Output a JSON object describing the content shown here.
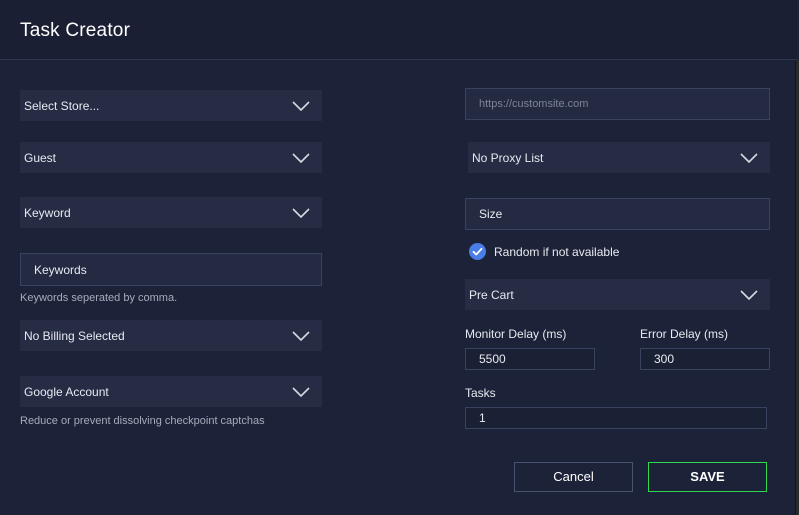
{
  "window": {
    "title": "Task Creator"
  },
  "left": {
    "store": {
      "value": "Select Store..."
    },
    "profile": {
      "value": "Guest"
    },
    "mode": {
      "value": "Keyword"
    },
    "keywords": {
      "placeholder": "Keywords",
      "helper": "Keywords seperated by comma."
    },
    "billing": {
      "value": "No Billing Selected"
    },
    "account": {
      "value": "Google Account",
      "helper": "Reduce or prevent dissolving checkpoint captchas"
    }
  },
  "right": {
    "site": {
      "placeholder": "https://customsite.com"
    },
    "proxy": {
      "value": "No Proxy List"
    },
    "size": {
      "placeholder": "Size"
    },
    "random": {
      "label": "Random if not available",
      "checked": true
    },
    "checkout": {
      "value": "Pre Cart"
    },
    "monitor_delay": {
      "label": "Monitor Delay (ms)",
      "value": "5500"
    },
    "error_delay": {
      "label": "Error Delay (ms)",
      "value": "300"
    },
    "tasks": {
      "label": "Tasks",
      "value": "1"
    }
  },
  "actions": {
    "cancel_label": "Cancel",
    "save_label": "SAVE"
  },
  "colors": {
    "background": "#1c2237",
    "field": "#252c44",
    "accent_check": "#4a7de6",
    "save_border": "#2fd84f"
  }
}
